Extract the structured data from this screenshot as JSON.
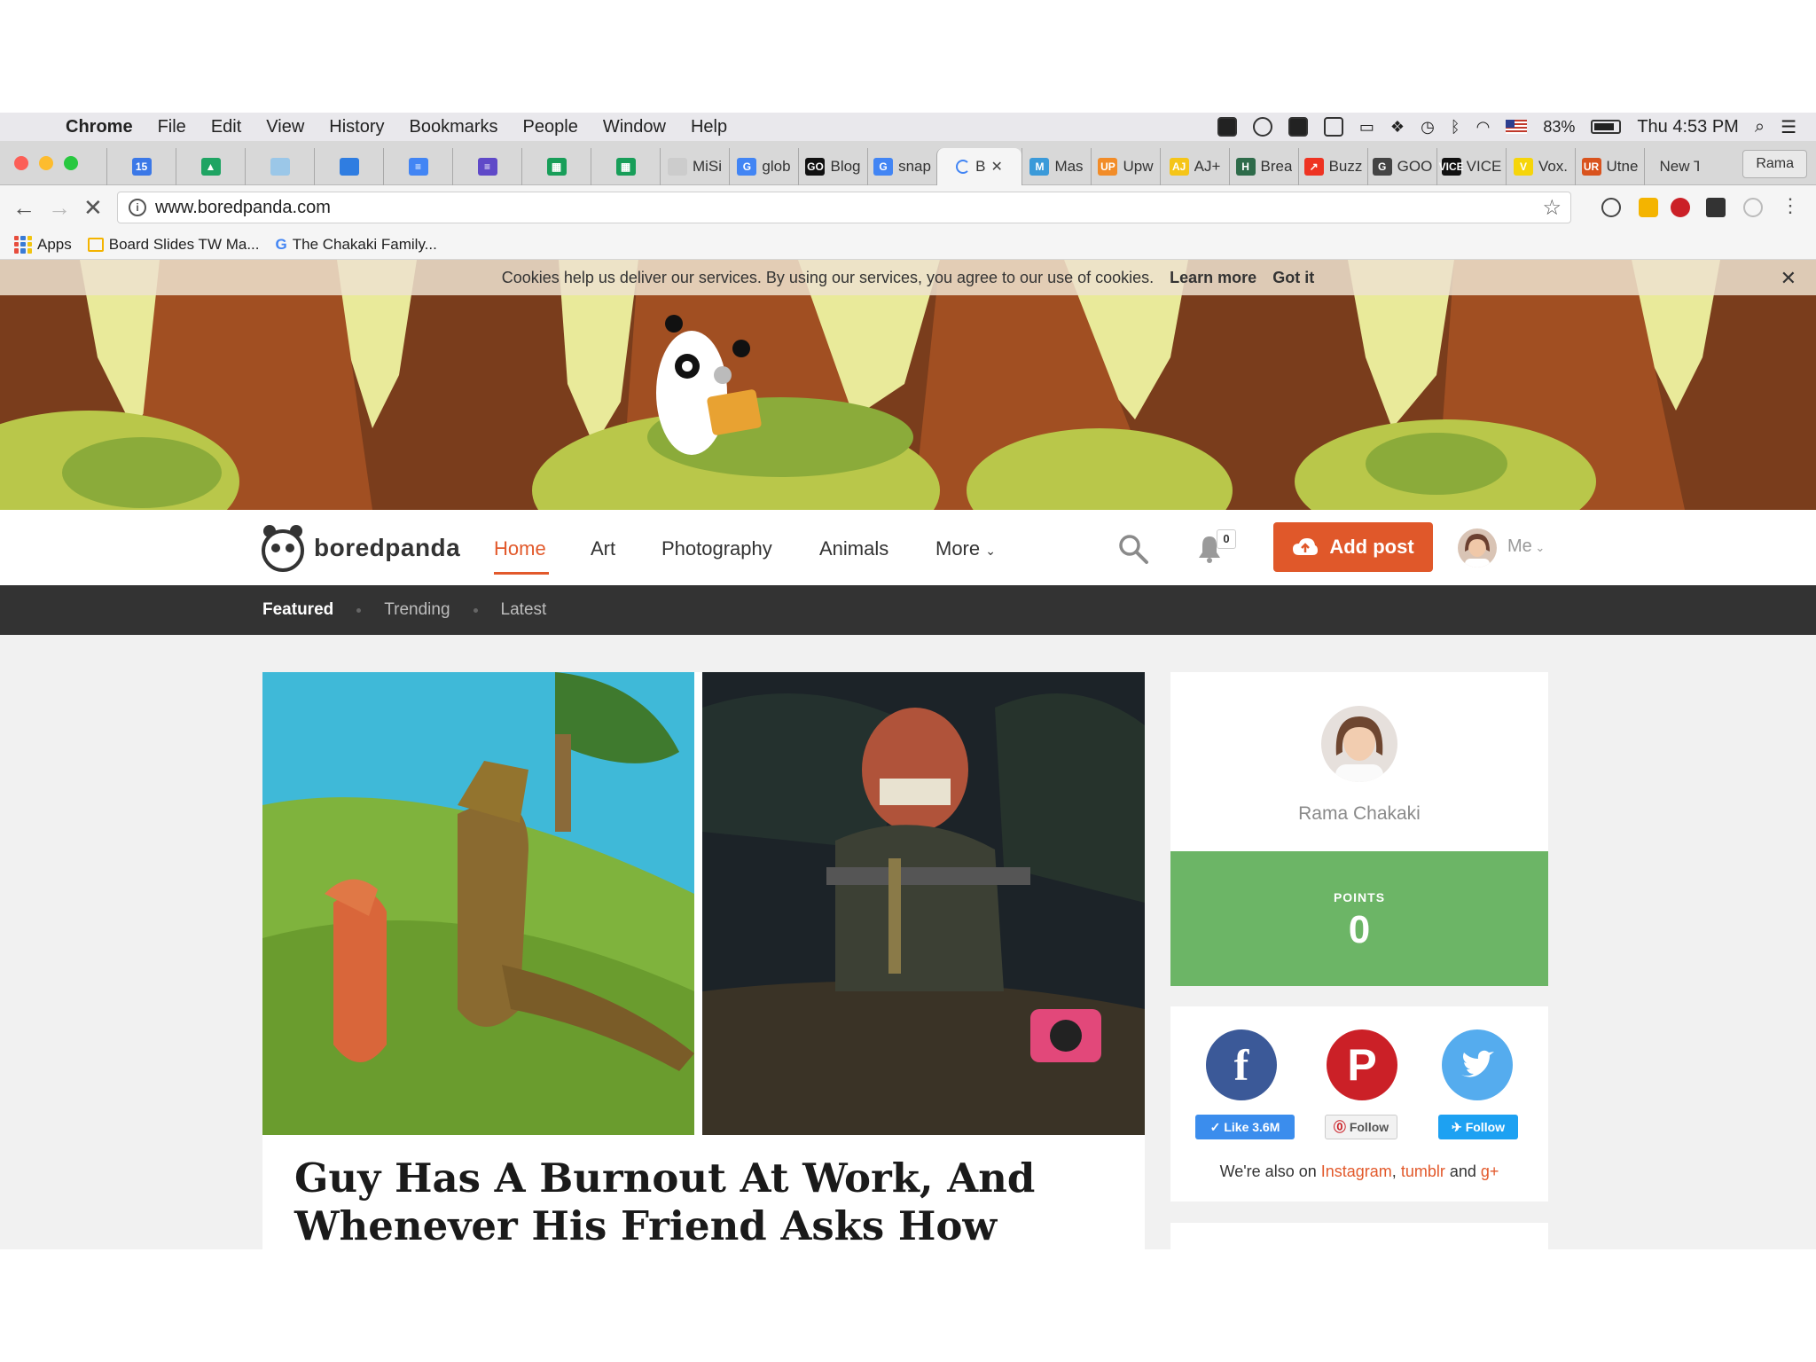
{
  "menubar": {
    "app": "Chrome",
    "items": [
      "File",
      "Edit",
      "View",
      "History",
      "Bookmarks",
      "People",
      "Window",
      "Help"
    ],
    "status": {
      "battery": "83%",
      "clock": "Thu 4:53 PM"
    }
  },
  "tabs": [
    {
      "label": "",
      "favicon_color": "#3b78e7",
      "favicon_text": "15"
    },
    {
      "label": "",
      "favicon_color": "#1fa463",
      "favicon_text": "▲"
    },
    {
      "label": "",
      "favicon_color": "#9bc7e8",
      "favicon_text": ""
    },
    {
      "label": "",
      "favicon_color": "#2f7de1",
      "favicon_text": ""
    },
    {
      "label": "",
      "favicon_color": "#4285f4",
      "favicon_text": "≡"
    },
    {
      "label": "",
      "favicon_color": "#5f49c8",
      "favicon_text": "≡"
    },
    {
      "label": "",
      "favicon_color": "#189e59",
      "favicon_text": "▦"
    },
    {
      "label": "",
      "favicon_color": "#189e59",
      "favicon_text": "▦"
    },
    {
      "label": "MiSi",
      "favicon_color": "#cccccc",
      "favicon_text": ""
    },
    {
      "label": "glob",
      "favicon_color": "#4285f4",
      "favicon_text": "G"
    },
    {
      "label": "Blog",
      "favicon_color": "#111111",
      "favicon_text": "GO"
    },
    {
      "label": "snap",
      "favicon_color": "#4285f4",
      "favicon_text": "G"
    },
    {
      "label": "B",
      "favicon_color": "",
      "favicon_text": "",
      "active": true
    },
    {
      "label": "Mas",
      "favicon_color": "#3b9ad9",
      "favicon_text": "M"
    },
    {
      "label": "Upw",
      "favicon_color": "#f28c28",
      "favicon_text": "UP"
    },
    {
      "label": "AJ+",
      "favicon_color": "#f5c518",
      "favicon_text": "AJ"
    },
    {
      "label": "Brea",
      "favicon_color": "#2e6b4a",
      "favicon_text": "H"
    },
    {
      "label": "Buzz",
      "favicon_color": "#ee3322",
      "favicon_text": "↗"
    },
    {
      "label": "GOO",
      "favicon_color": "#444444",
      "favicon_text": "G"
    },
    {
      "label": "VICE",
      "favicon_color": "#111111",
      "favicon_text": "VICE"
    },
    {
      "label": "Vox.",
      "favicon_color": "#f6d50a",
      "favicon_text": "V"
    },
    {
      "label": "Utne",
      "favicon_color": "#d9531e",
      "favicon_text": "UR"
    },
    {
      "label": "New Ta",
      "favicon_color": "",
      "favicon_text": ""
    }
  ],
  "profile_chip": "Rama",
  "omnibox": {
    "url": "www.boredpanda.com"
  },
  "bookmarks": [
    {
      "label": "Apps"
    },
    {
      "label": "Board Slides TW Ma..."
    },
    {
      "label": "The Chakaki Family..."
    }
  ],
  "cookie_bar": {
    "text": "Cookies help us deliver our services. By using our services, you agree to our use of cookies.",
    "learn_more": "Learn more",
    "got_it": "Got it",
    "close": "✕"
  },
  "site_nav": {
    "logo_text": "boredpanda",
    "links": [
      "Home",
      "Art",
      "Photography",
      "Animals",
      "More"
    ],
    "notifications": "0",
    "add_post": "Add post",
    "me": "Me"
  },
  "sub_nav": [
    "Featured",
    "Trending",
    "Latest"
  ],
  "feature": {
    "headline": "Guy Has A Burnout At Work, And Whenever His Friend Asks How He’s"
  },
  "profile_card": {
    "name": "Rama Chakaki",
    "points_label": "POINTS",
    "points_value": "0"
  },
  "social": {
    "facebook_btn": "Like 3.6M",
    "pinterest_btn": "Follow",
    "twitter_btn": "Follow",
    "also_prefix": "We're also on",
    "instagram": "Instagram",
    "tumblr": "tumblr",
    "and": "and",
    "gplus": "g+"
  },
  "colors": {
    "accent": "#e2592b",
    "points_green": "#6cb566",
    "facebook": "#3b5998",
    "pinterest": "#cb2027",
    "twitter": "#55acee"
  }
}
